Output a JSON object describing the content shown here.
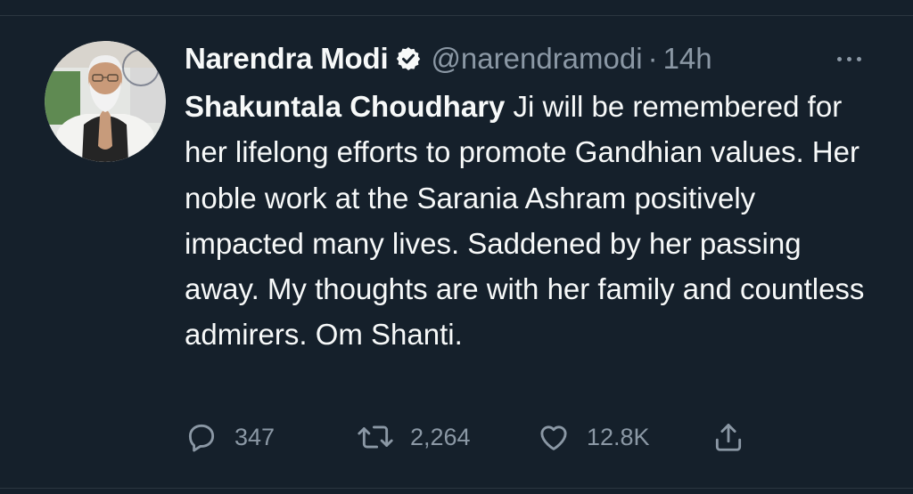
{
  "tweet": {
    "author_name": "Narendra Modi",
    "handle": "@narendramodi",
    "separator": "·",
    "time": "14h",
    "text_bold": "Shakuntala Choudhary",
    "text_rest": " Ji will be remembered for her lifelong efforts to promote Gandhian values. Her noble work at the Sarania Ashram positively impacted many lives. Saddened by her passing away. My thoughts are with her family and countless admirers. Om Shanti."
  },
  "actions": {
    "reply_count": "347",
    "retweet_count": "2,264",
    "like_count": "12.8K"
  },
  "icons": {
    "verified": "verified-badge-icon",
    "more": "more-options-icon",
    "reply": "reply-icon",
    "retweet": "retweet-icon",
    "like": "like-heart-icon",
    "share": "share-icon"
  },
  "colors": {
    "background": "#15202b",
    "text_primary": "#f7f9f9",
    "text_secondary": "#8b98a5",
    "divider": "#2b3640"
  }
}
